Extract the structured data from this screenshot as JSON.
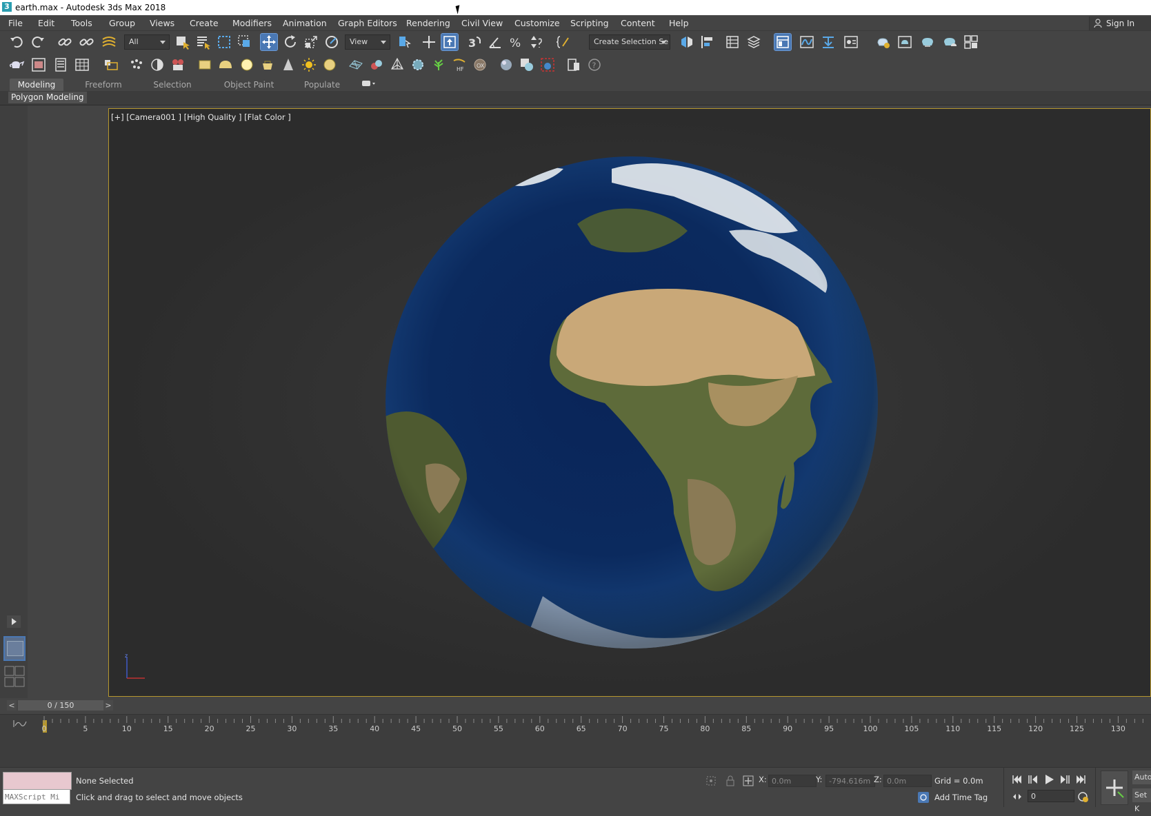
{
  "window": {
    "title": "earth.max - Autodesk 3ds Max 2018",
    "icon": "3ds-max-icon"
  },
  "menu": [
    "File",
    "Edit",
    "Tools",
    "Group",
    "Views",
    "Create",
    "Modifiers",
    "Animation",
    "Graph Editors",
    "Rendering",
    "Civil View",
    "Customize",
    "Scripting",
    "Content",
    "Help"
  ],
  "signin": "Sign In",
  "toolbar": {
    "filter_dropdown": "All",
    "refcoord_dropdown": "View",
    "selection_set": "Create Selection Se"
  },
  "ribbon": {
    "tabs": [
      "Modeling",
      "Freeform",
      "Selection",
      "Object Paint",
      "Populate"
    ],
    "active_tab": "Modeling",
    "sub_panel": "Polygon Modeling"
  },
  "viewport": {
    "label": "[+] [Camera001 ] [High Quality ] [Flat Color ]",
    "axis_label": "z"
  },
  "timeline": {
    "frame_display": "0 / 150",
    "prev": "<",
    "next": ">",
    "ticks": [
      "0",
      "5",
      "10",
      "15",
      "20",
      "25",
      "30",
      "35",
      "40",
      "45",
      "50",
      "55",
      "60",
      "65",
      "70",
      "75",
      "80",
      "85",
      "90",
      "95",
      "100",
      "105",
      "110",
      "115",
      "120",
      "125",
      "130"
    ]
  },
  "status": {
    "selection": "None Selected",
    "hint": "Click and drag to select and move objects",
    "maxscript_placeholder": "MAXScript Mi",
    "x_label": "X:",
    "x_value": "0.0m",
    "y_label": "Y:",
    "y_value": "-794.616m",
    "z_label": "Z:",
    "z_value": "0.0m",
    "grid": "Grid = 0.0m",
    "add_time_tag": "Add Time Tag",
    "current_frame": "0",
    "auto_key": "Auto",
    "set_key": "Set K"
  },
  "colors": {
    "viewport_border": "#b6982f",
    "active_button": "#4a78b4",
    "maxscript_bg": "#e8c8cf"
  }
}
